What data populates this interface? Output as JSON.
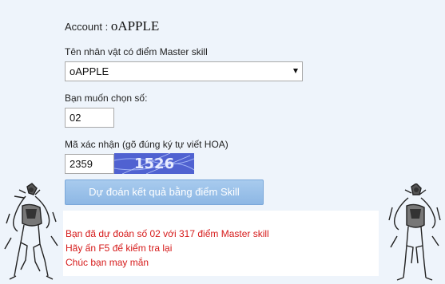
{
  "account": {
    "label": "Account :",
    "value": "oAPPLE"
  },
  "character": {
    "label": "Tên nhân vật có điểm Master skill",
    "selected": "oAPPLE"
  },
  "number": {
    "label": "Bạn muốn chọn số:",
    "value": "02"
  },
  "captcha": {
    "label": "Mã xác nhận (gõ đúng ký tự viết HOA)",
    "value": "2359",
    "image_text": "1526"
  },
  "submit_label": "Dự đoán kết quả bằng điểm Skill",
  "result": {
    "lines": [
      "Bạn đã dự đoán số 02 với 317 điểm Master skill",
      "Hãy ấn F5 để kiểm tra lại",
      "Chúc bạn may mắn"
    ]
  },
  "colors": {
    "background": "#eef4fb",
    "button": "#8db7e4",
    "result_text": "#d61a1a",
    "captcha_bg": "#3f4fc6"
  }
}
